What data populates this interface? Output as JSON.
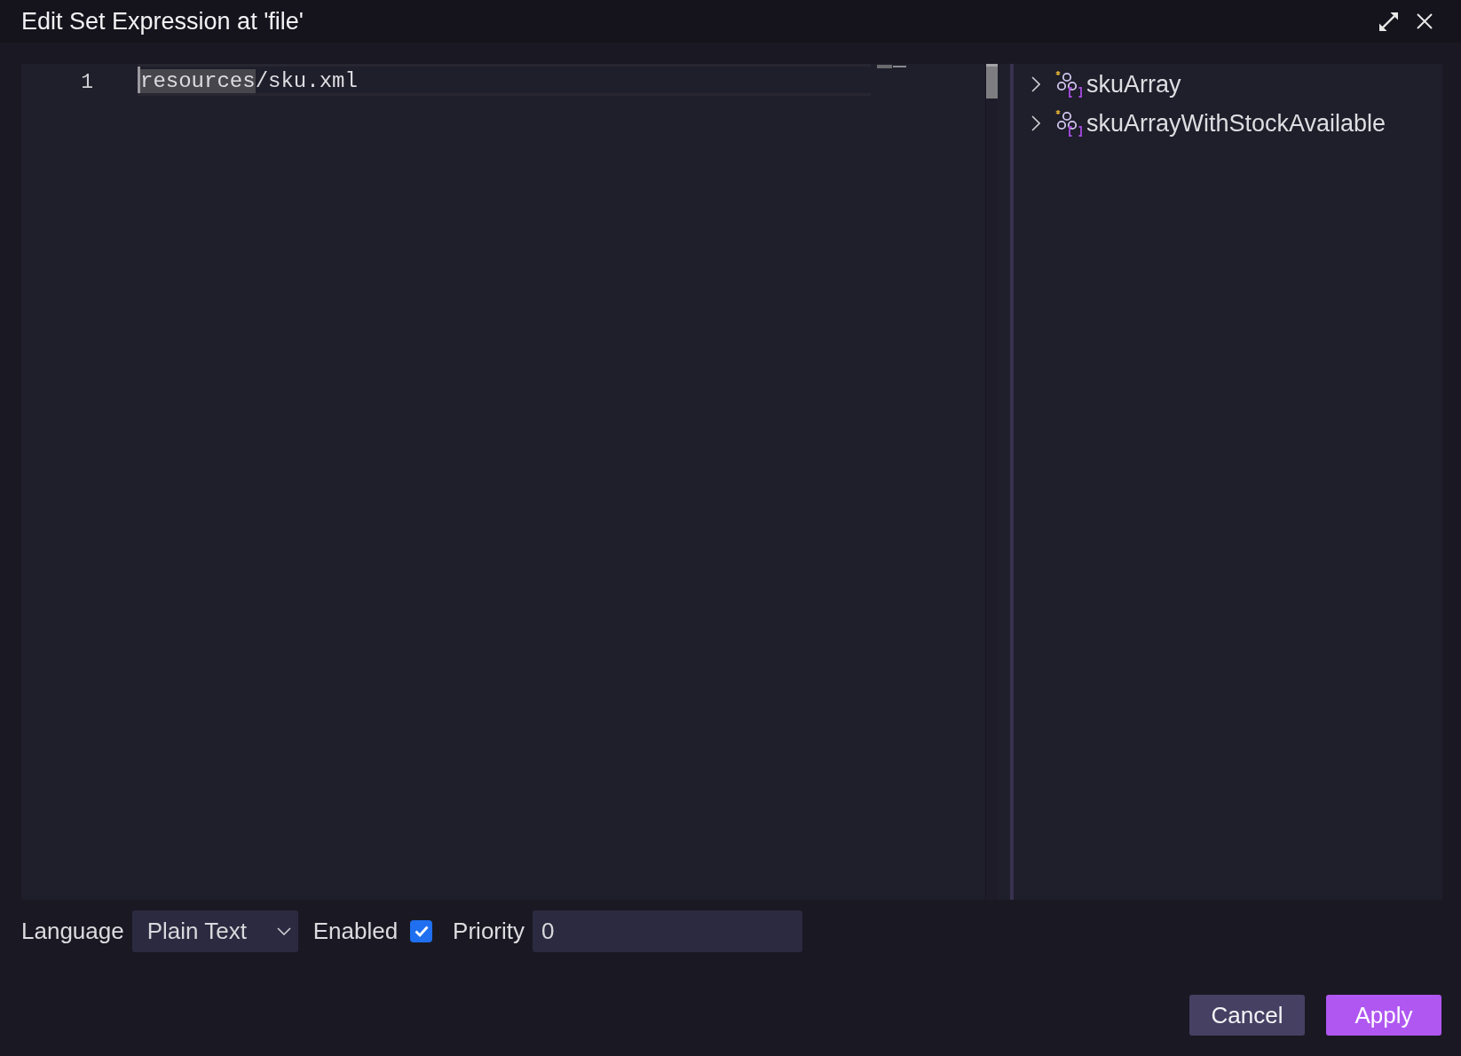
{
  "dialog": {
    "title": "Edit Set Expression at 'file'"
  },
  "editor": {
    "lines": [
      {
        "number": "1",
        "current": true,
        "cursor": true,
        "segments": [
          {
            "text": "resources",
            "selected": true
          },
          {
            "text": "/sku.xml",
            "selected": false
          }
        ]
      }
    ]
  },
  "variables": [
    {
      "label": "skuArray",
      "expanded": false
    },
    {
      "label": "skuArrayWithStockAvailable",
      "expanded": false
    }
  ],
  "footer": {
    "language": {
      "label": "Language",
      "value": "Plain Text"
    },
    "enabled": {
      "label": "Enabled",
      "checked": true
    },
    "priority": {
      "label": "Priority",
      "value": "0"
    }
  },
  "buttons": [
    {
      "label": "Cancel",
      "kind": "secondary"
    },
    {
      "label": "Apply",
      "kind": "primary"
    }
  ]
}
